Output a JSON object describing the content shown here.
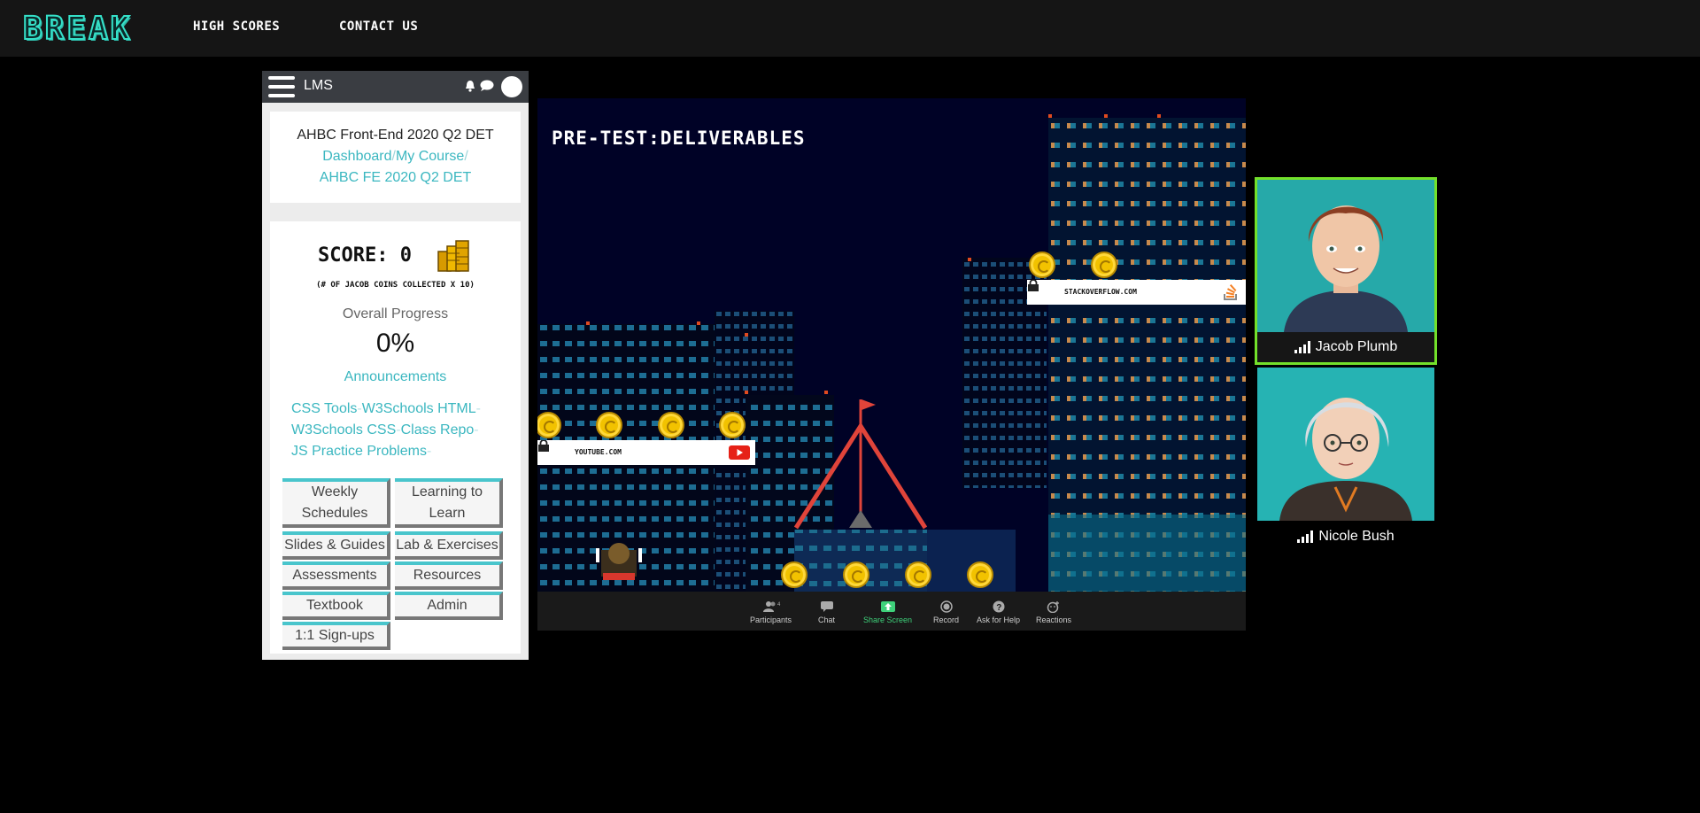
{
  "site": {
    "logo": "BREAK",
    "nav": [
      {
        "label": "HIGH SCORES"
      },
      {
        "label": "CONTACT US"
      }
    ]
  },
  "lms": {
    "title": "LMS",
    "header_icons": [
      "hamburger-menu-icon",
      "bell-icon",
      "chat-bubble-icon",
      "user-avatar-icon"
    ],
    "course": {
      "title": "AHBC Front-End 2020 Q2 DET",
      "breadcrumbs": [
        "Dashboard",
        "My Course",
        "AHBC FE 2020 Q2 DET"
      ],
      "separator": "/"
    },
    "score": {
      "label": "SCORE:",
      "value": "0",
      "subtitle": "(# OF JACOB COINS COLLECTED X 10)"
    },
    "progress": {
      "label": "Overall Progress",
      "value": "0%"
    },
    "announcements": "Announcements",
    "links": [
      "CSS Tools",
      "W3Schools HTML",
      "W3Schools CSS",
      "Class Repo",
      "JS Practice Problems"
    ],
    "link_separator": "-",
    "buttons": [
      {
        "label": "Weekly Schedules"
      },
      {
        "label": "Learning to Learn"
      },
      {
        "label": "Slides & Guides"
      },
      {
        "label": "Lab & Exercises"
      },
      {
        "label": "Assessments"
      },
      {
        "label": "Resources"
      },
      {
        "label": "Textbook"
      },
      {
        "label": "Admin"
      },
      {
        "label": "1:1 Sign-ups"
      }
    ]
  },
  "game": {
    "title": "PRE-TEST:DELIVERABLES",
    "platforms": [
      {
        "url": "YOUTUBE.COM",
        "icon": "youtube-icon"
      },
      {
        "url": "STACKOVERFLOW.COM",
        "icon": "stackoverflow-icon"
      }
    ],
    "coin_count": 10
  },
  "zoom_toolbar": {
    "items": [
      {
        "label": "Participants",
        "badge": "4",
        "icon": "participants-icon"
      },
      {
        "label": "Chat",
        "icon": "chat-icon"
      },
      {
        "label": "Share Screen",
        "icon": "share-screen-icon"
      },
      {
        "label": "Record",
        "icon": "record-icon"
      },
      {
        "label": "Ask for Help",
        "icon": "help-icon"
      },
      {
        "label": "Reactions",
        "icon": "reactions-icon"
      }
    ]
  },
  "participants": [
    {
      "name": "Jacob Plumb",
      "active_speaker": true
    },
    {
      "name": "Nicole Bush",
      "active_speaker": false
    }
  ],
  "colors": {
    "accent": "#3bb7c0",
    "active_speaker_border": "#73e02a",
    "share_screen": "#3ed17a",
    "background": "#000000"
  }
}
